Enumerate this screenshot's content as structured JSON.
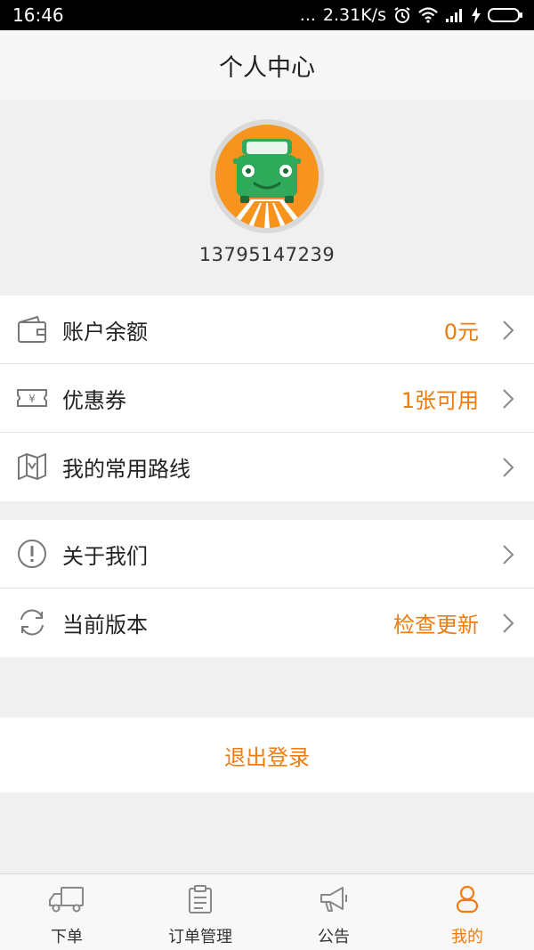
{
  "status_bar": {
    "time": "16:46",
    "network_speed": "2.31K/s",
    "dots": "..."
  },
  "header": {
    "title": "个人中心"
  },
  "profile": {
    "phone": "13795147239",
    "avatar_icon": "car-avatar-icon"
  },
  "menu_group_1": [
    {
      "label": "账户余额",
      "value": "0元",
      "icon": "wallet-icon"
    },
    {
      "label": "优惠券",
      "value": "1张可用",
      "icon": "coupon-icon"
    },
    {
      "label": "我的常用路线",
      "value": "",
      "icon": "map-icon"
    }
  ],
  "menu_group_2": [
    {
      "label": "关于我们",
      "value": "",
      "icon": "info-icon"
    },
    {
      "label": "当前版本",
      "value": "检查更新",
      "icon": "refresh-icon"
    }
  ],
  "logout": {
    "label": "退出登录"
  },
  "tabs": [
    {
      "label": "下单",
      "icon": "truck-icon",
      "active": false
    },
    {
      "label": "订单管理",
      "icon": "clipboard-icon",
      "active": false
    },
    {
      "label": "公告",
      "icon": "megaphone-icon",
      "active": false
    },
    {
      "label": "我的",
      "icon": "user-icon",
      "active": true
    }
  ],
  "colors": {
    "accent": "#f07b0f",
    "background": "#f0f0f0",
    "avatar_orange": "#f7941d",
    "car_green": "#2eaa5a"
  }
}
